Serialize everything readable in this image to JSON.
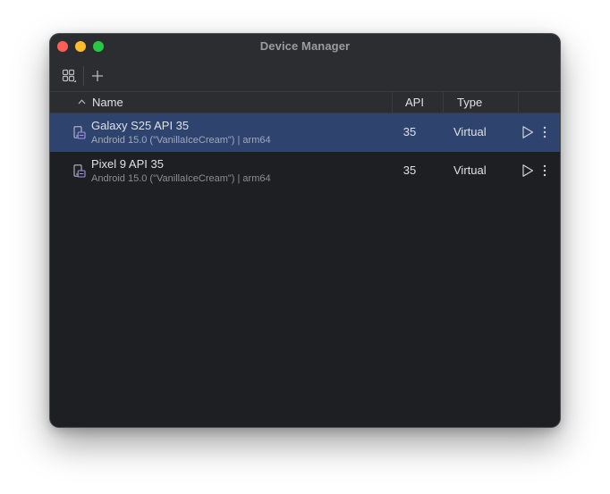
{
  "window": {
    "title": "Device Manager"
  },
  "toolbar": {
    "device_mirror_icon": "grid-icon",
    "add_icon": "plus-icon"
  },
  "table": {
    "sort_indicator": "^",
    "columns": {
      "name": "Name",
      "api": "API",
      "type": "Type"
    },
    "rows": [
      {
        "name": "Galaxy S25 API 35",
        "details": "Android 15.0 (\"VanillaIceCream\") | arm64",
        "api": "35",
        "type": "Virtual",
        "selected": true
      },
      {
        "name": "Pixel 9 API 35",
        "details": "Android 15.0 (\"VanillaIceCream\") | arm64",
        "api": "35",
        "type": "Virtual",
        "selected": false
      }
    ]
  },
  "colors": {
    "window_bg": "#2b2d30",
    "table_bg": "#1e1f22",
    "selection": "#2e436e",
    "device_icon_accent": "#a88ee6"
  }
}
